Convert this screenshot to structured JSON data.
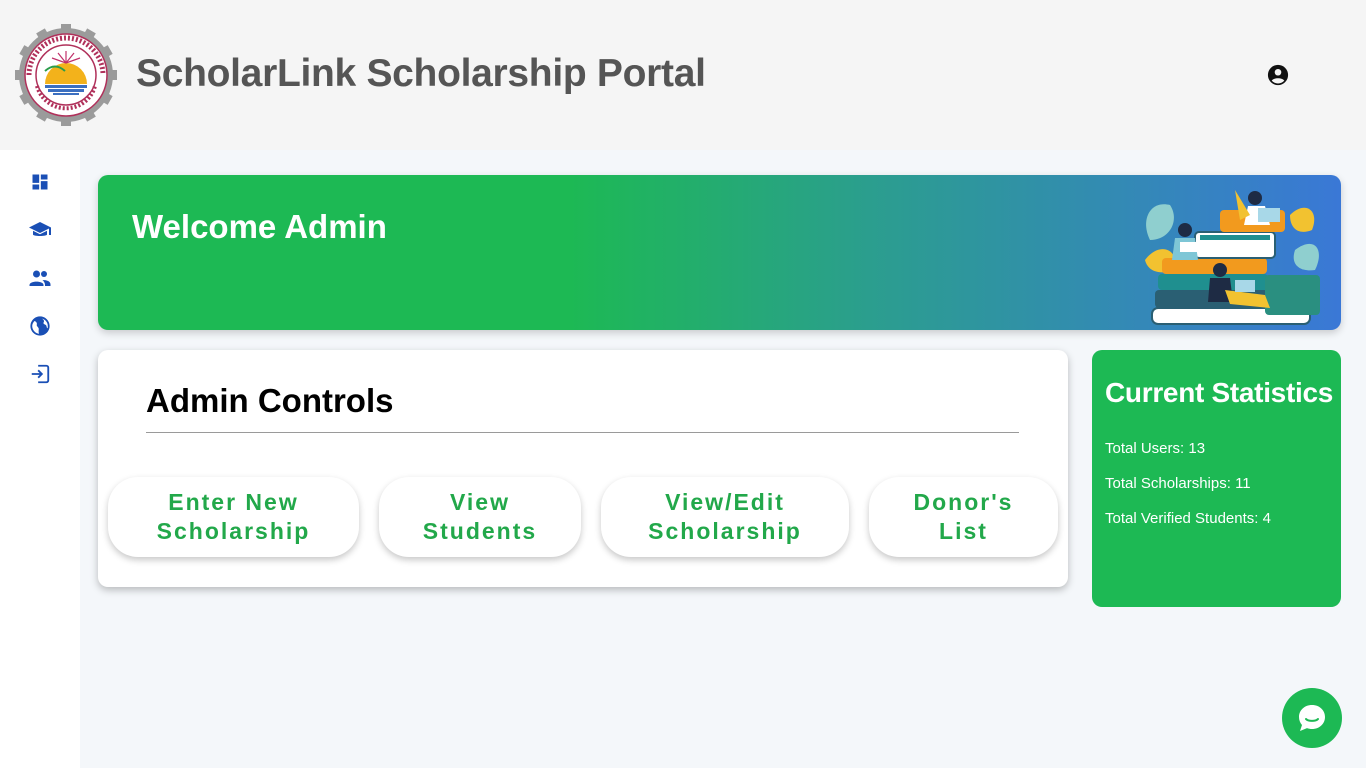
{
  "header": {
    "title": "ScholarLink Scholarship Portal",
    "logo_icon": "university-seal-icon",
    "logo_text": "NED University of Engineering & Technology Karachi",
    "user_icon": "account-circle-icon"
  },
  "sidebar": {
    "items": [
      {
        "icon": "dashboard-icon"
      },
      {
        "icon": "graduation-cap-icon"
      },
      {
        "icon": "people-icon"
      },
      {
        "icon": "globe-icon"
      },
      {
        "icon": "logout-icon"
      }
    ]
  },
  "banner": {
    "title": "Welcome Admin",
    "illustration": "students-reading-on-books-illustration"
  },
  "controls": {
    "title": "Admin Controls",
    "buttons": [
      {
        "line1": "Enter New",
        "line2": "Scholarship"
      },
      {
        "line1": "View",
        "line2": "Students"
      },
      {
        "line1": "View/Edit",
        "line2": "Scholarship"
      },
      {
        "line1": "Donor's",
        "line2": "List"
      }
    ]
  },
  "stats": {
    "title": "Current Statistics",
    "lines": [
      "Total Users: 13",
      "Total Scholarships: 11",
      "Total Verified Students: 4"
    ]
  },
  "chat": {
    "icon": "chat-bubble-icon"
  },
  "colors": {
    "accent_green": "#1db954",
    "button_text_green": "#22a84a",
    "sidebar_icon_blue": "#1a4fb5",
    "banner_gradient_end": "#3a78d6"
  }
}
